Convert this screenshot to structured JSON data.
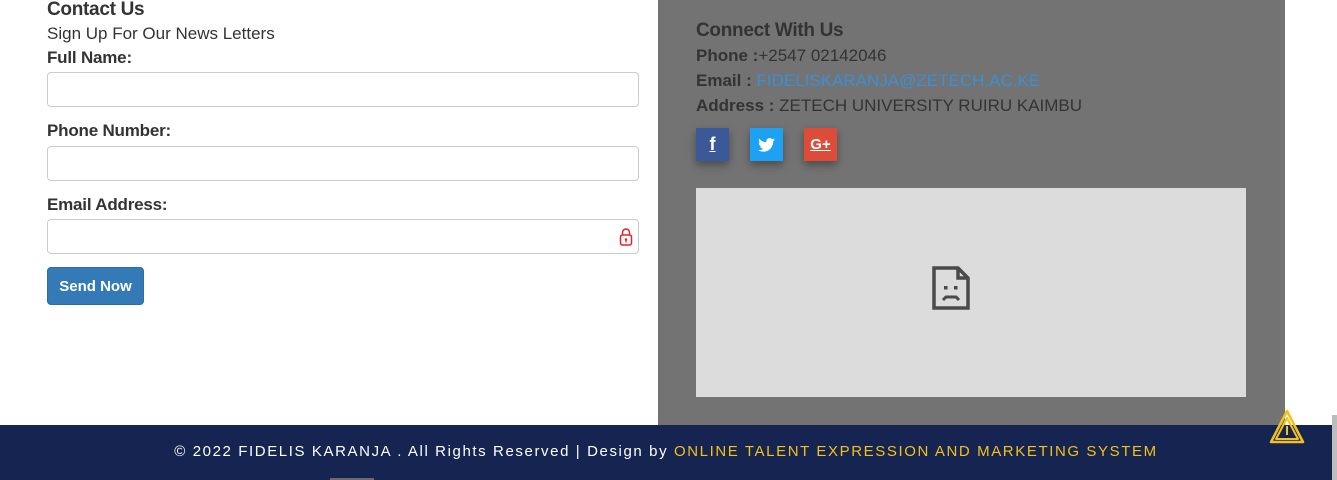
{
  "contact": {
    "heading": "Contact Us",
    "subheading": "Sign Up For Our News Letters",
    "fields": [
      {
        "label": "Full Name:",
        "value": "",
        "placeholder": ""
      },
      {
        "label": "Phone Number:",
        "value": "",
        "placeholder": ""
      },
      {
        "label": "Email Address:",
        "value": "",
        "placeholder": ""
      }
    ],
    "submit_label": "Send Now"
  },
  "connect": {
    "heading": "Connect With Us",
    "phone_label": "Phone :",
    "phone_value": "+2547 02142046",
    "email_label": "Email :",
    "email_value": "FIDELISKARANJA@ZETECH.AC.KE",
    "address_label": "Address :",
    "address_value": "ZETECH UNIVERSITY RUIRU KAIMBU",
    "social": {
      "facebook_glyph": "f",
      "googleplus_glyph": "G+"
    }
  },
  "footer": {
    "copyright": "© 2022 FIDELIS KARANJA . All Rights Reserved | Design by",
    "designer": "ONLINE TALENT EXPRESSION AND MARKETING SYSTEM"
  },
  "colors": {
    "primary_button": "#337ab7",
    "panel_grey": "#737373",
    "footer_navy": "#152451",
    "footer_brand": "#f3c11a",
    "link_blue": "#3b8fd6",
    "facebook": "#3b5998",
    "twitter": "#1da1f2",
    "googleplus": "#dd4b39",
    "lock_red": "#d9262c"
  },
  "icons": {
    "lock": "lock-icon",
    "facebook": "facebook-icon",
    "twitter": "twitter-icon",
    "googleplus": "google-plus-icon",
    "broken_image": "broken-image-icon",
    "scroll_top": "scroll-to-top-icon"
  }
}
